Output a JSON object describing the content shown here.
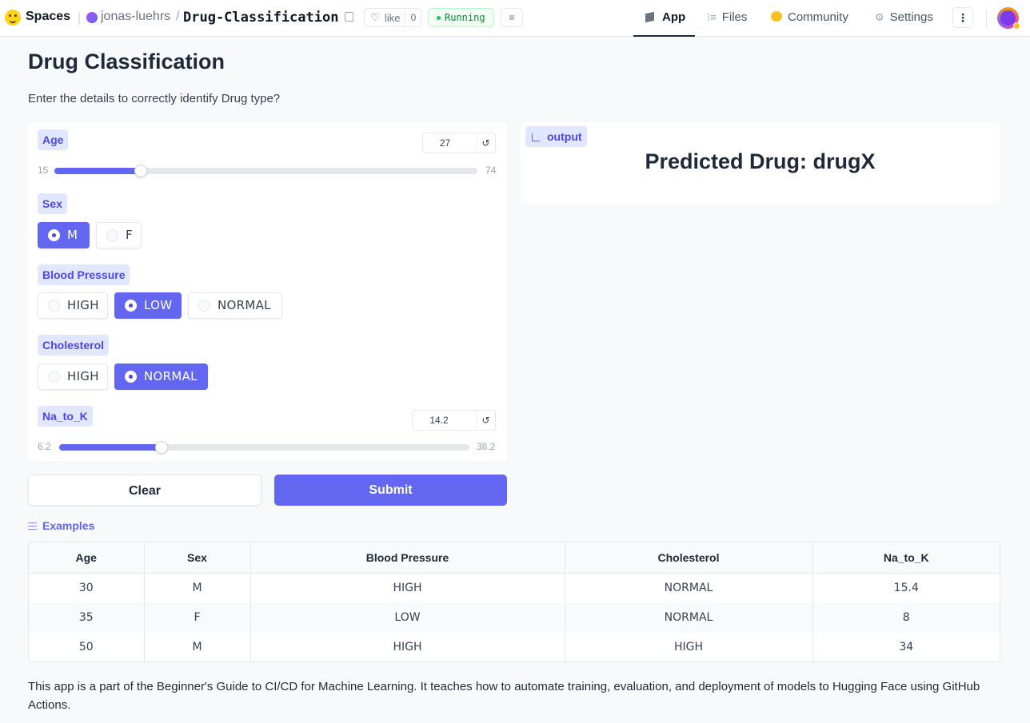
{
  "topbar": {
    "brand": "Spaces",
    "owner": "jonas-luehrs",
    "separator": "/",
    "repo": "Drug-Classification",
    "like_label": "like",
    "like_count": "0",
    "status": "Running",
    "tabs": [
      {
        "label": "App",
        "icon": "app-icon",
        "active": true
      },
      {
        "label": "Files",
        "icon": "files-icon",
        "active": false
      },
      {
        "label": "Community",
        "icon": "community-icon",
        "active": false
      },
      {
        "label": "Settings",
        "icon": "settings-icon",
        "active": false
      }
    ]
  },
  "page": {
    "title": "Drug Classification",
    "subtitle": "Enter the details to correctly identify Drug type?"
  },
  "inputs": {
    "age": {
      "label": "Age",
      "value": "27",
      "min": "15",
      "max": "74",
      "fraction": 0.2034
    },
    "sex": {
      "label": "Sex",
      "options": [
        "M",
        "F"
      ],
      "selected": "M"
    },
    "blood_pressure": {
      "label": "Blood Pressure",
      "options": [
        "HIGH",
        "LOW",
        "NORMAL"
      ],
      "selected": "LOW"
    },
    "cholesterol": {
      "label": "Cholesterol",
      "options": [
        "HIGH",
        "NORMAL"
      ],
      "selected": "NORMAL"
    },
    "na_to_k": {
      "label": "Na_to_K",
      "value": "14.2",
      "min": "6.2",
      "max": "38.2",
      "fraction": 0.25
    }
  },
  "output": {
    "label": "output",
    "prediction": "Predicted Drug: drugX"
  },
  "buttons": {
    "clear": "Clear",
    "submit": "Submit"
  },
  "examples": {
    "heading": "Examples",
    "columns": [
      "Age",
      "Sex",
      "Blood Pressure",
      "Cholesterol",
      "Na_to_K"
    ],
    "rows": [
      [
        "30",
        "M",
        "HIGH",
        "NORMAL",
        "15.4"
      ],
      [
        "35",
        "F",
        "LOW",
        "NORMAL",
        "8"
      ],
      [
        "50",
        "M",
        "HIGH",
        "HIGH",
        "34"
      ]
    ]
  },
  "footer": "This app is a part of the Beginner's Guide to CI/CD for Machine Learning. It teaches how to automate training, evaluation, and deployment of models to Hugging Face using GitHub Actions.",
  "colors": {
    "accent": "#6366f1",
    "chip_bg": "#e0e7ff",
    "status_green": "#22c55e"
  }
}
